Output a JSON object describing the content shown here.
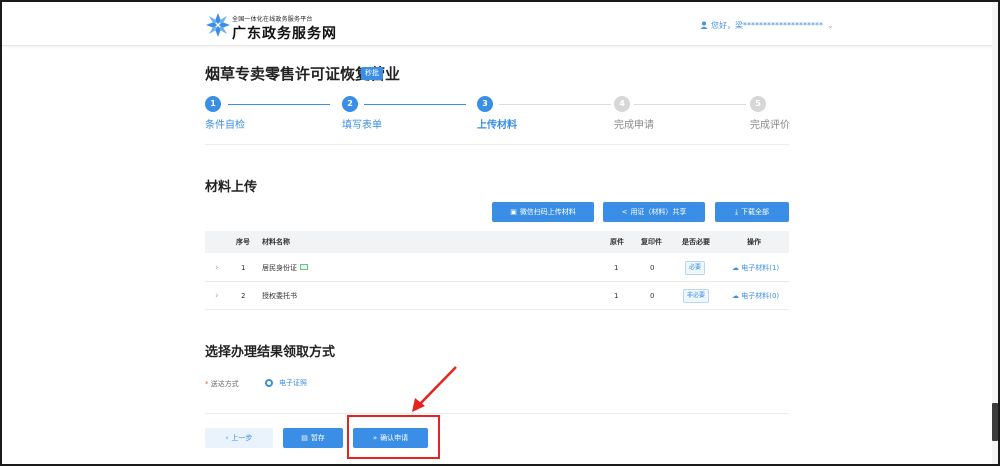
{
  "header": {
    "platform_subtitle": "全国一体化在线政务服务平台",
    "platform_name": "广东政务服务网",
    "user_greeting": "您好，梁********************"
  },
  "service": {
    "title": "烟草专卖零售许可证恢复营业",
    "badge": "秒批"
  },
  "steps": [
    {
      "number": "1",
      "label": "条件自检"
    },
    {
      "number": "2",
      "label": "填写表单"
    },
    {
      "number": "3",
      "label": "上传材料"
    },
    {
      "number": "4",
      "label": "完成申请"
    },
    {
      "number": "5",
      "label": "完成评价"
    }
  ],
  "current_step": 3,
  "materials": {
    "section_title": "材料上传",
    "wechat_upload_label": "微信扫码上传材料",
    "share_label": "用证（材料）共享",
    "download_all_label": "下载全部",
    "columns": [
      "序号",
      "材料名称",
      "原件",
      "复印件",
      "是否必要",
      "操作"
    ],
    "rows": [
      {
        "index": "1",
        "name": "居民身份证",
        "original": "1",
        "copy": "0",
        "required": "必要",
        "action": "电子材料(1)"
      },
      {
        "index": "2",
        "name": "授权委托书",
        "original": "1",
        "copy": "0",
        "required": "非必要",
        "action": "电子材料(0)"
      }
    ]
  },
  "delivery": {
    "section_title": "选择办理结果领取方式",
    "label": "送达方式",
    "option": "电子证照"
  },
  "footer": {
    "prev_label": "上一步",
    "save_label": "暂存",
    "confirm_label": "确认申请"
  },
  "colors": {
    "accent": "#3a8ee6",
    "annotation": "#e6231d"
  }
}
